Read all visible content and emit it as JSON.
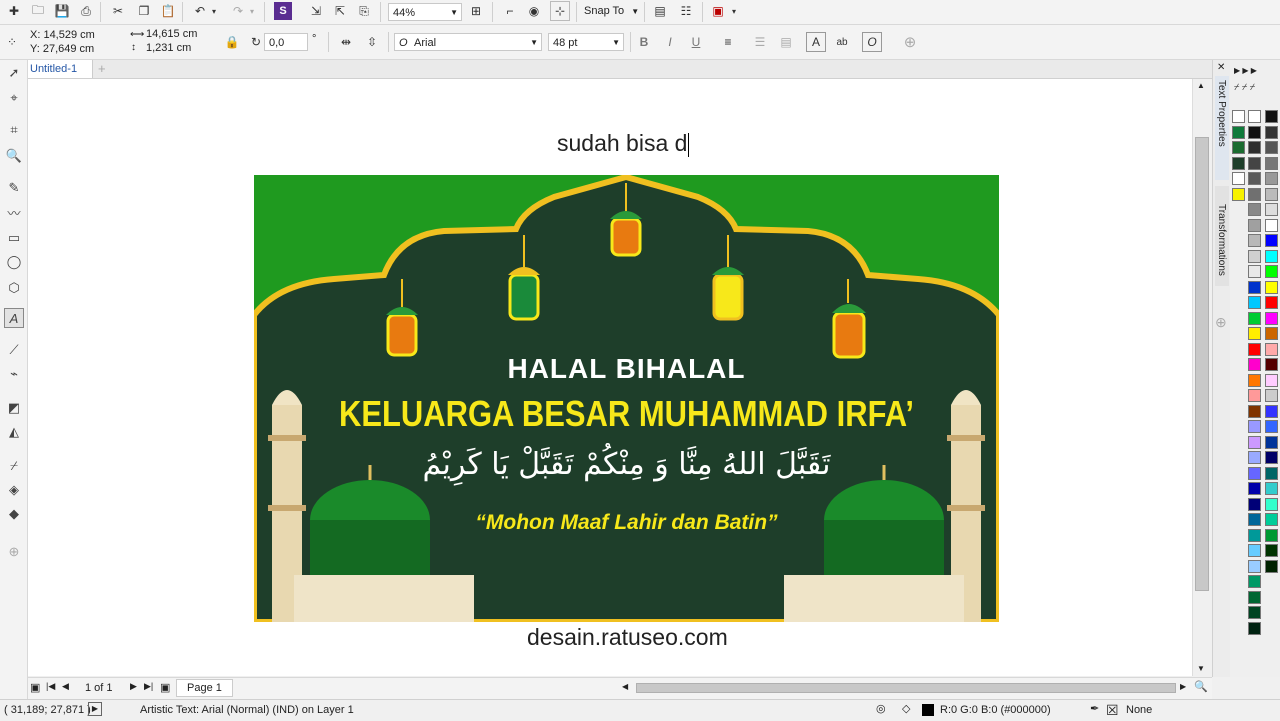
{
  "toolbar": {
    "zoom": "44%",
    "snap_label": "Snap To"
  },
  "property_bar": {
    "x": "X: 14,529 cm",
    "y": "Y: 27,649 cm",
    "width": "14,615 cm",
    "height": "1,231 cm",
    "rotation": "0,0",
    "degree_symbol": "°",
    "font_name": "Arial",
    "font_size": "48 pt"
  },
  "tab": {
    "title": "Untitled-1"
  },
  "dockers": {
    "text_properties": "Text Properties",
    "transformations": "Transformations"
  },
  "canvas": {
    "typed_text": "sudah bisa d",
    "footer_text": "desain.ratuseo.com"
  },
  "banner": {
    "heading1": "HALAL BIHALAL",
    "heading2": "KELUARGA BESAR MUHAMMAD IRFA’",
    "arabic": "تَقَبَّلَ اللهُ مِنَّا وَ مِنْكُمْ تَقَبَّلْ يَا كَرِيْمُ",
    "tagline": "“Mohon Maaf Lahir dan Batin”",
    "colors": {
      "green": "#1f9a1f",
      "dark": "#1e3e2a",
      "yellow": "#f7e81a",
      "gold": "#f0c020"
    }
  },
  "page_nav": {
    "counter": "1 of 1",
    "page_tab": "Page 1"
  },
  "status": {
    "coords": "( 31,189; 27,871 )",
    "object_info": "Artistic Text: Arial (Normal) (IND) on Layer 1",
    "fill_info": "R:0 G:0 B:0 (#000000)",
    "outline_info": "None"
  },
  "palette": {
    "col1": [
      "#ffffff",
      "#0f7a3a",
      "#1a6b2f",
      "#1e3e2a",
      "#ffffff",
      "#f7f200"
    ],
    "col2": [
      "#ffffff",
      "#111111",
      "#2e2e2e",
      "#444444",
      "#5a5a5a",
      "#707070",
      "#888888",
      "#a0a0a0",
      "#b8b8b8",
      "#d0d0d0",
      "#e8e8e8",
      "#0033cc",
      "#00c8ff",
      "#00cc33",
      "#ffee00",
      "#ff0000",
      "#ff00cc",
      "#ff7700",
      "#ff9999",
      "#7f3300",
      "#9999ff",
      "#cc99ff",
      "#99aaff",
      "#6666ff",
      "#0000aa",
      "#000077",
      "#006699",
      "#009999",
      "#66ccff",
      "#99ccff",
      "#009966",
      "#006633",
      "#004422",
      "#002211"
    ],
    "col3": [
      "#111111",
      "#333333",
      "#555555",
      "#777777",
      "#999999",
      "#bbbbbb",
      "#dddddd",
      "#ffffff",
      "#0000ff",
      "#00ffff",
      "#00ff00",
      "#ffff00",
      "#ff0000",
      "#ff00ff",
      "#cc6600",
      "#ffaaaa",
      "#550000",
      "#ffccff",
      "#cccccc",
      "#3333ff",
      "#3366ff",
      "#003399",
      "#000066",
      "#006666",
      "#33cccc",
      "#33ffcc",
      "#00cc99",
      "#009933",
      "#003300",
      "#002200"
    ]
  }
}
